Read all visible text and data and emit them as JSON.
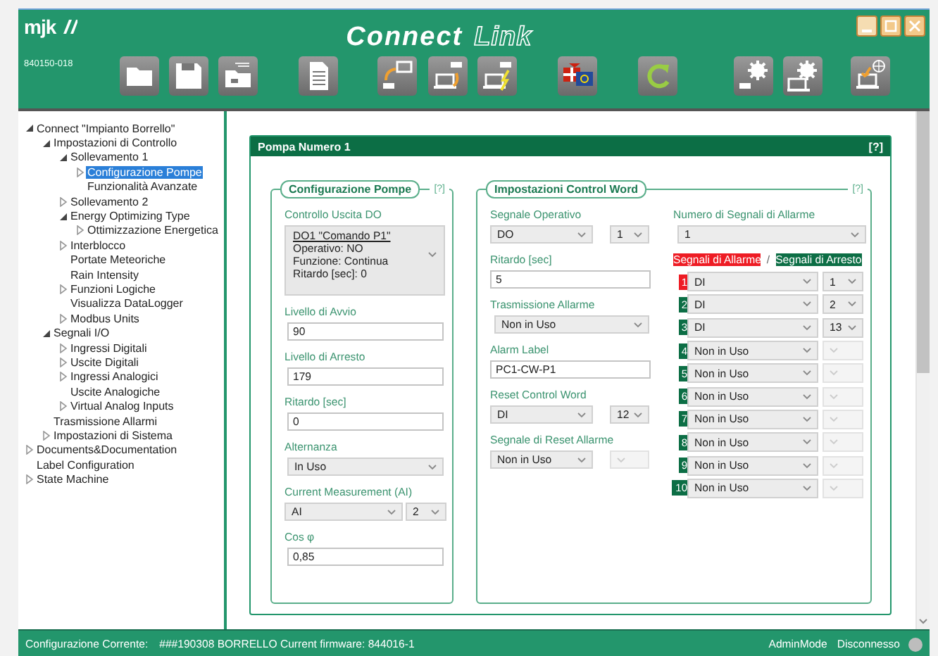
{
  "header": {
    "logo": "mjk",
    "serial": "840150-018",
    "title_bold": "Connect",
    "title_outline": "Link"
  },
  "tree": [
    {
      "label": "Connect \"Impianto Borrello\"",
      "expanded": true,
      "selected": false,
      "children": [
        {
          "label": "Impostazioni di Controllo",
          "expanded": true,
          "selected": false,
          "children": [
            {
              "label": "Sollevamento 1",
              "expanded": true,
              "selected": false,
              "children": [
                {
                  "label": "Configurazione Pompe",
                  "expanded": false,
                  "selected": true
                },
                {
                  "label": "Funzionalità Avanzate",
                  "selected": false
                }
              ]
            },
            {
              "label": "Sollevamento 2",
              "expanded": false,
              "selected": false
            },
            {
              "label": "Energy Optimizing Type",
              "expanded": true,
              "selected": false,
              "children": [
                {
                  "label": "Ottimizzazione Energetica",
                  "expanded": false,
                  "selected": false
                }
              ]
            },
            {
              "label": "Interblocco",
              "expanded": false,
              "selected": false
            },
            {
              "label": "Portate Meteoriche",
              "selected": false
            },
            {
              "label": "Rain Intensity",
              "selected": false
            },
            {
              "label": "Funzioni Logiche",
              "expanded": false,
              "selected": false
            },
            {
              "label": "Visualizza DataLogger",
              "selected": false
            },
            {
              "label": "Modbus Units",
              "expanded": false,
              "selected": false
            }
          ]
        },
        {
          "label": "Segnali I/O",
          "expanded": true,
          "selected": false,
          "children": [
            {
              "label": "Ingressi Digitali",
              "expanded": false,
              "selected": false
            },
            {
              "label": "Uscite Digitali",
              "expanded": false,
              "selected": false
            },
            {
              "label": "Ingressi Analogici",
              "expanded": false,
              "selected": false
            },
            {
              "label": "Uscite Analogiche",
              "selected": false
            },
            {
              "label": "Virtual Analog Inputs",
              "expanded": false,
              "selected": false
            }
          ]
        },
        {
          "label": "Trasmissione Allarmi",
          "selected": false
        },
        {
          "label": "Impostazioni di Sistema",
          "expanded": false,
          "selected": false
        }
      ]
    },
    {
      "label": "Documents&Documentation",
      "expanded": false,
      "selected": false
    },
    {
      "label": "Label Configuration",
      "selected": false
    },
    {
      "label": "State Machine",
      "expanded": false,
      "selected": false
    }
  ],
  "panel": {
    "title": "Pompa Numero 1",
    "help": "[?]",
    "pump_config": {
      "title": "Configurazione Pompe",
      "help": "[?]",
      "output_label": "Controllo Uscita DO",
      "output_lines": [
        "DO1 \"Comando P1\"",
        "Operativo: NO",
        "Funzione: Continua",
        "Ritardo [sec]: 0"
      ],
      "fields": [
        {
          "kind": "input",
          "label": "Livello di Avvio",
          "value": "90"
        },
        {
          "kind": "input",
          "label": "Livello di Arresto",
          "value": "179"
        },
        {
          "kind": "input",
          "label": "Ritardo [sec]",
          "value": "0"
        },
        {
          "kind": "select",
          "label": "Alternanza",
          "value": "In Uso"
        },
        {
          "kind": "select-pair",
          "label": "Current Measurement (AI)",
          "value": "AI",
          "value_2": "2"
        },
        {
          "kind": "input",
          "label": "Cos  φ",
          "value": "0,85"
        }
      ]
    },
    "control_word": {
      "title": "Impostazioni Control Word",
      "help": "[?]",
      "fields": [
        {
          "kind": "select-pair",
          "label": "Segnale Operativo",
          "value": "DO",
          "value_2": "1"
        },
        {
          "kind": "input",
          "label": "Ritardo [sec]",
          "value": "5"
        },
        {
          "kind": "select",
          "label": "Trasmissione Allarme",
          "value": "Non in Uso"
        },
        {
          "kind": "input",
          "label": "Alarm Label",
          "value": "PC1-CW-P1"
        },
        {
          "kind": "select-pair",
          "label": "Reset Control Word",
          "value": "DI",
          "value_2": "12"
        },
        {
          "kind": "select-pair",
          "label": "Segnale di Reset Allarme",
          "value": "Non in Uso",
          "value_2_disabled": true
        }
      ],
      "alarm_count_label": "Numero di Segnali di Allarme",
      "alarm_count": "1",
      "alarm_legend": "Segnali di Allarme",
      "legend_separator": "/",
      "stop_legend": "Segnali di Arresto",
      "signals": [
        {
          "number": "1",
          "kind": "alarm",
          "signal": "DI",
          "channel": "1"
        },
        {
          "number": "2",
          "kind": "stop",
          "signal": "DI",
          "channel": "2"
        },
        {
          "number": "3",
          "kind": "stop",
          "signal": "DI",
          "channel": "13"
        },
        {
          "number": "4",
          "kind": "stop",
          "signal": "Non in Uso",
          "channel_disabled": true
        },
        {
          "number": "5",
          "kind": "stop",
          "signal": "Non in Uso",
          "channel_disabled": true
        },
        {
          "number": "6",
          "kind": "stop",
          "signal": "Non in Uso",
          "channel_disabled": true
        },
        {
          "number": "7",
          "kind": "stop",
          "signal": "Non in Uso",
          "channel_disabled": true
        },
        {
          "number": "8",
          "kind": "stop",
          "signal": "Non in Uso",
          "channel_disabled": true
        },
        {
          "number": "9",
          "kind": "stop",
          "signal": "Non in Uso",
          "channel_disabled": true
        },
        {
          "number": "10",
          "kind": "stop",
          "signal": "Non in Uso",
          "channel_disabled": true
        }
      ]
    }
  },
  "status_bar": {
    "label": "Configurazione Corrente:",
    "config": "###190308 BORRELLO Current firmware: 844016-1",
    "mode": "AdminMode",
    "connection": "Disconnesso",
    "connected": false
  }
}
